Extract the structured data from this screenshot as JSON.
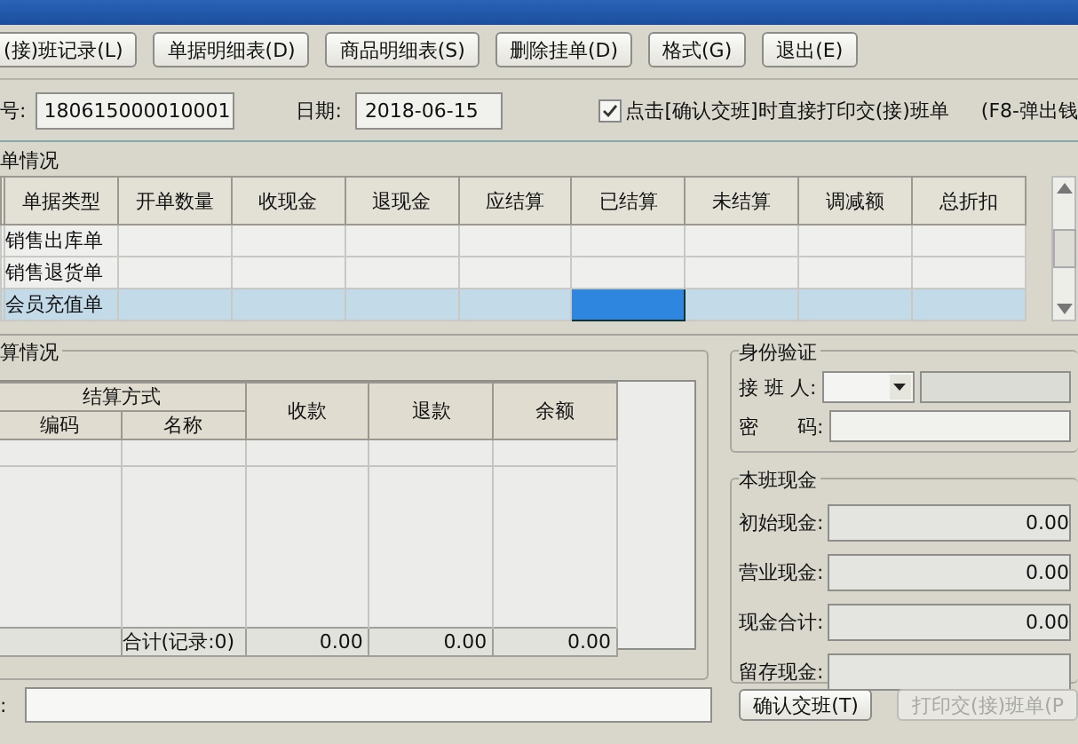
{
  "toolbar": {
    "buttons": [
      "(接)班记录(L)",
      "单据明细表(D)",
      "商品明细表(S)",
      "删除挂单(D)",
      "格式(G)",
      "退出(E)"
    ]
  },
  "info": {
    "number_label": "号:",
    "number": "180615000010001",
    "date_label": "日期:",
    "date": "2018-06-15",
    "print_option": {
      "label": "点击[确认交班]时直接打印交(接)班单",
      "checked": true
    },
    "hint": "(F8-弹出钱"
  },
  "documents": {
    "title": "单情况",
    "columns": [
      {
        "label": "单据类型",
        "focused": false
      },
      {
        "label": "开单数量",
        "focused": false
      },
      {
        "label": "收现金",
        "focused": false
      },
      {
        "label": "退现金",
        "focused": false
      },
      {
        "label": "应结算",
        "focused": false
      },
      {
        "label": "已结算",
        "focused": true
      },
      {
        "label": "未结算",
        "focused": false
      },
      {
        "label": "调减额",
        "focused": false
      },
      {
        "label": "总折扣",
        "focused": false
      }
    ],
    "rows": [
      {
        "type": "销售出库单",
        "selected": false
      },
      {
        "type": "销售退货单",
        "selected": false
      },
      {
        "type": "会员充值单",
        "selected": true
      }
    ]
  },
  "settlement": {
    "title": "算情况",
    "group_header": "结算方式",
    "code_header": "编码",
    "name_header": "名称",
    "amount_headers": [
      "收款",
      "退款",
      "余额"
    ],
    "total_label": "合计(记录:0)",
    "totals": [
      "0.00",
      "0.00",
      "0.00"
    ]
  },
  "identity": {
    "title": "身份验证",
    "receiver_label": "接 班 人:",
    "password_label": "密　　码:"
  },
  "cash": {
    "title": "本班现金",
    "fields": [
      {
        "label": "初始现金:",
        "value": "0.00"
      },
      {
        "label": "营业现金:",
        "value": "0.00"
      },
      {
        "label": "现金合计:",
        "value": "0.00"
      },
      {
        "label": "留存现金:"
      }
    ]
  },
  "bottom": {
    "note_label": ":",
    "buttons": [
      {
        "label": "确认交班(T)",
        "disabled": false
      },
      {
        "label": "打印交(接)班单(P",
        "disabled": true
      }
    ]
  }
}
